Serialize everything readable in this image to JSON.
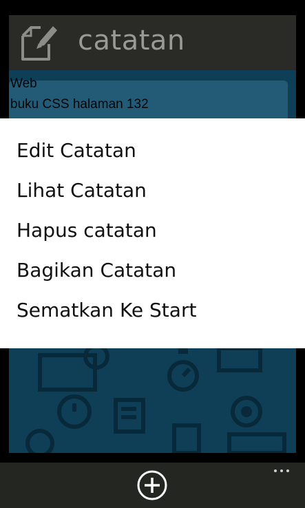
{
  "header": {
    "title": "catatan",
    "icon": "edit-note-icon"
  },
  "note": {
    "category": "Web",
    "title": "buku CSS halaman 132"
  },
  "context_menu": {
    "items": [
      {
        "label": "Edit Catatan"
      },
      {
        "label": "Lihat Catatan"
      },
      {
        "label": "Hapus catatan"
      },
      {
        "label": "Bagikan Catatan"
      },
      {
        "label": "Sematkan Ke Start"
      }
    ]
  },
  "app_bar": {
    "add_icon": "add-icon",
    "more_icon": "ellipsis-icon"
  },
  "colors": {
    "header_bg": "#2a2b27",
    "content_bg": "#0f3f57",
    "menu_bg": "#ffffff",
    "app_bar_bg": "#242622"
  }
}
